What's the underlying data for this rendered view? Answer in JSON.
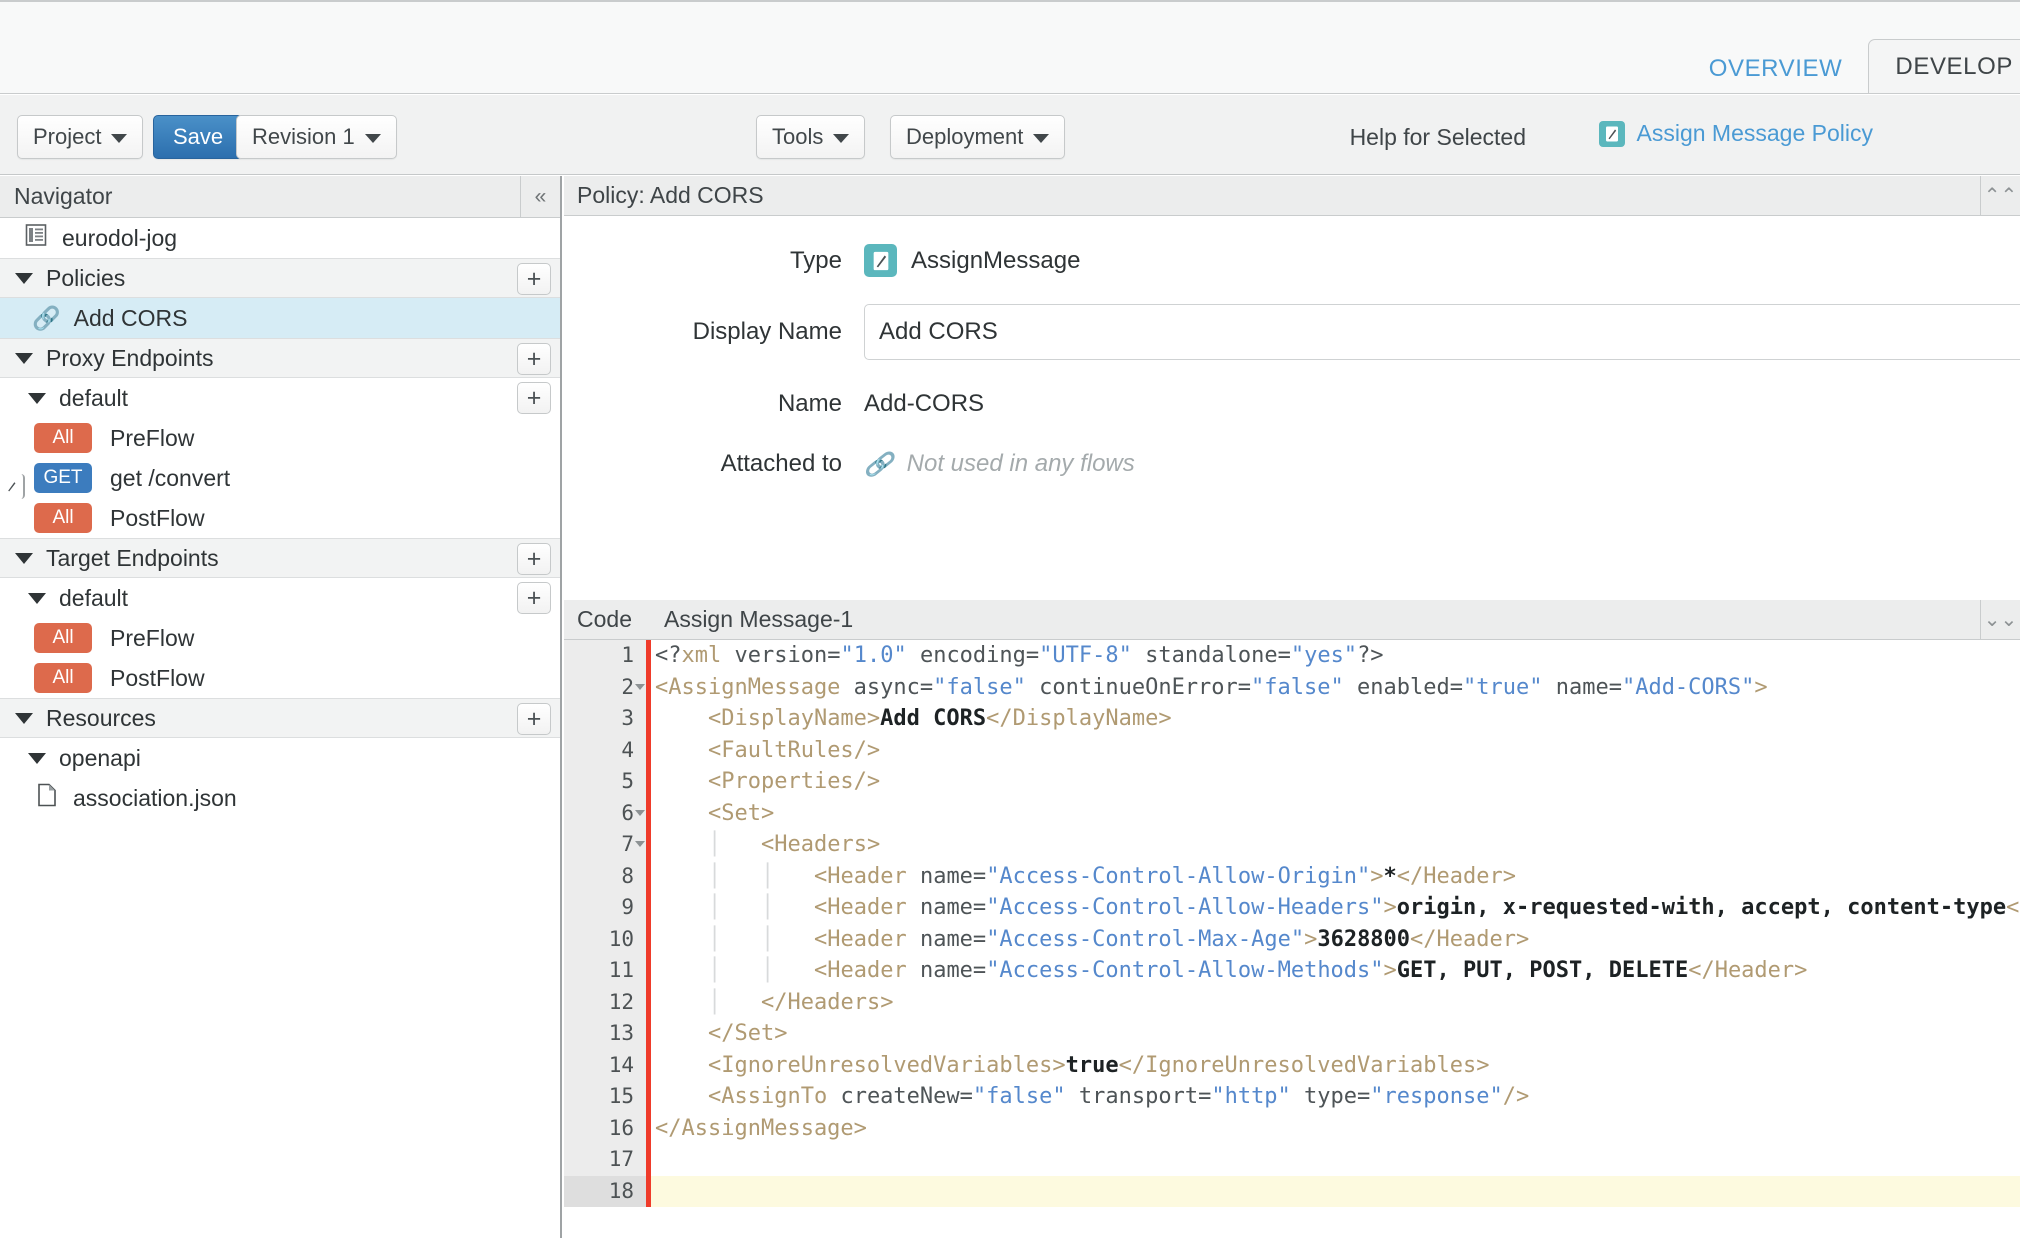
{
  "tabs": [
    {
      "label": "OVERVIEW",
      "active": false
    },
    {
      "label": "DEVELOP",
      "active": true
    }
  ],
  "toolbar": {
    "project_label": "Project",
    "save_label": "Save",
    "revision_label": "Revision 1",
    "tools_label": "Tools",
    "deployment_label": "Deployment",
    "help_label": "Help for Selected",
    "help_link_label": "Assign Message Policy"
  },
  "navigator": {
    "title": "Navigator",
    "collapse_icon": "«",
    "proxy_name": "eurodol-jog",
    "add_icon": "+",
    "sections": [
      {
        "label": "Policies"
      },
      {
        "label": "Proxy Endpoints"
      },
      {
        "label": "Target Endpoints"
      },
      {
        "label": "Resources"
      }
    ],
    "policies": [
      {
        "label": "Add CORS",
        "selected": true
      }
    ],
    "proxy_endpoints": {
      "name": "default",
      "flows": [
        {
          "method": "All",
          "label": "PreFlow"
        },
        {
          "method": "GET",
          "label": "get /convert"
        },
        {
          "method": "All",
          "label": "PostFlow"
        }
      ]
    },
    "target_endpoints": {
      "name": "default",
      "flows": [
        {
          "method": "All",
          "label": "PreFlow"
        },
        {
          "method": "All",
          "label": "PostFlow"
        }
      ]
    },
    "resources": {
      "folder": "openapi",
      "files": [
        {
          "label": "association.json"
        }
      ]
    }
  },
  "detail": {
    "header": "Policy: Add CORS",
    "collapse_icon": "⌃⌃",
    "type_label": "Type",
    "type_value": "AssignMessage",
    "display_name_label": "Display Name",
    "display_name_value": "Add CORS",
    "display_name_placeholder": "",
    "name_label": "Name",
    "name_value": "Add-CORS",
    "attached_label": "Attached to",
    "attached_value": "Not used in any flows"
  },
  "code": {
    "tab_code_label": "Code",
    "tab_policy_label": "Assign Message-1",
    "collapse_icon": "⌄⌄",
    "active_line": 18,
    "lines": [
      {
        "n": 1,
        "fold": false,
        "html": "<span class='a'>&lt;?</span><span class='t'>xml</span><span class='a'> version=</span><span class='v'>\"1.0\"</span><span class='a'> encoding=</span><span class='v'>\"UTF-8\"</span><span class='a'> standalone=</span><span class='v'>\"yes\"</span><span class='a'>?&gt;</span>"
      },
      {
        "n": 2,
        "fold": true,
        "html": "<span class='t'>&lt;AssignMessage</span><span class='a'> async=</span><span class='v'>\"false\"</span><span class='a'> continueOnError=</span><span class='v'>\"false\"</span><span class='a'> enabled=</span><span class='v'>\"true\"</span><span class='a'> name=</span><span class='v'>\"Add-CORS\"</span><span class='t'>&gt;</span>"
      },
      {
        "n": 3,
        "fold": false,
        "html": "    <span class='t'>&lt;DisplayName&gt;</span><span class='x'>Add CORS</span><span class='t'>&lt;/DisplayName&gt;</span>"
      },
      {
        "n": 4,
        "fold": false,
        "html": "    <span class='t'>&lt;FaultRules/&gt;</span>"
      },
      {
        "n": 5,
        "fold": false,
        "html": "    <span class='t'>&lt;Properties/&gt;</span>"
      },
      {
        "n": 6,
        "fold": true,
        "html": "    <span class='t'>&lt;Set&gt;</span>"
      },
      {
        "n": 7,
        "fold": true,
        "html": "    <span class='indentguide'>│</span>   <span class='t'>&lt;Headers&gt;</span>"
      },
      {
        "n": 8,
        "fold": false,
        "html": "    <span class='indentguide'>│</span>   <span class='indentguide'>│</span>   <span class='t'>&lt;Header</span><span class='a'> name=</span><span class='v'>\"Access-Control-Allow-Origin\"</span><span class='t'>&gt;</span><span class='x'>*</span><span class='t'>&lt;/Header&gt;</span>"
      },
      {
        "n": 9,
        "fold": false,
        "html": "    <span class='indentguide'>│</span>   <span class='indentguide'>│</span>   <span class='t'>&lt;Header</span><span class='a'> name=</span><span class='v'>\"Access-Control-Allow-Headers\"</span><span class='t'>&gt;</span><span class='x'>origin, x-requested-with, accept, content-type</span><span class='t'>&lt;/Header&gt;</span>"
      },
      {
        "n": 10,
        "fold": false,
        "html": "    <span class='indentguide'>│</span>   <span class='indentguide'>│</span>   <span class='t'>&lt;Header</span><span class='a'> name=</span><span class='v'>\"Access-Control-Max-Age\"</span><span class='t'>&gt;</span><span class='x'>3628800</span><span class='t'>&lt;/Header&gt;</span>"
      },
      {
        "n": 11,
        "fold": false,
        "html": "    <span class='indentguide'>│</span>   <span class='indentguide'>│</span>   <span class='t'>&lt;Header</span><span class='a'> name=</span><span class='v'>\"Access-Control-Allow-Methods\"</span><span class='t'>&gt;</span><span class='x'>GET, PUT, POST, DELETE</span><span class='t'>&lt;/Header&gt;</span>"
      },
      {
        "n": 12,
        "fold": false,
        "html": "    <span class='indentguide'>│</span>   <span class='t'>&lt;/Headers&gt;</span>"
      },
      {
        "n": 13,
        "fold": false,
        "html": "    <span class='t'>&lt;/Set&gt;</span>"
      },
      {
        "n": 14,
        "fold": false,
        "html": "    <span class='t'>&lt;IgnoreUnresolvedVariables&gt;</span><span class='x'>true</span><span class='t'>&lt;/IgnoreUnresolvedVariables&gt;</span>"
      },
      {
        "n": 15,
        "fold": false,
        "html": "    <span class='t'>&lt;AssignTo</span><span class='a'> createNew=</span><span class='v'>\"false\"</span><span class='a'> transport=</span><span class='v'>\"http\"</span><span class='a'> type=</span><span class='v'>\"response\"</span><span class='t'>/&gt;</span>"
      },
      {
        "n": 16,
        "fold": false,
        "html": "<span class='t'>&lt;/AssignMessage&gt;</span>"
      },
      {
        "n": 17,
        "fold": false,
        "html": ""
      },
      {
        "n": 18,
        "fold": false,
        "html": ""
      }
    ]
  },
  "colors": {
    "accent_blue": "#4a9ad4",
    "save_blue": "#2c6fae",
    "policy_teal": "#5bb7bd",
    "badge_all": "#dd6a4c",
    "badge_get": "#3c7cbe",
    "selection": "#d6ecf5",
    "active_line": "#fdfadf",
    "error_rail": "#ef3b2a"
  }
}
